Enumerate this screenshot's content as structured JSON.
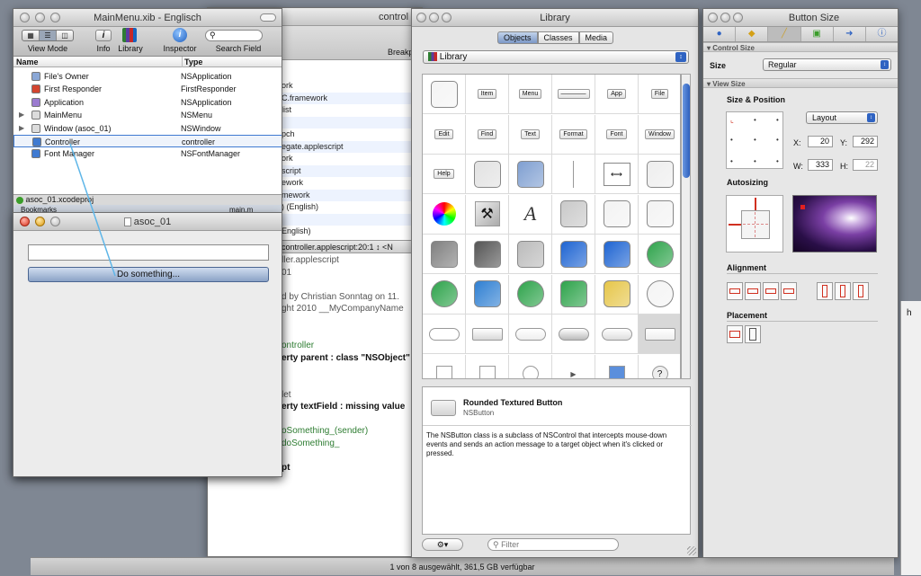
{
  "background": {
    "color": "#7f8793"
  },
  "project_window": {
    "title": "control",
    "toolbar_label": "Breakp",
    "code_lines": [
      {
        "text": "ork",
        "color": "#222"
      },
      {
        "text": "C.framework",
        "color": "#222"
      },
      {
        "text": "list",
        "color": "#222"
      },
      {
        "text": "",
        "color": "#222"
      },
      {
        "text": "pch",
        "color": "#222"
      },
      {
        "text": "egate.applescript",
        "color": "#222"
      },
      {
        "text": "ork",
        "color": "#222"
      },
      {
        "text": "script",
        "color": "#222"
      },
      {
        "text": "ework",
        "color": "#222"
      },
      {
        "text": "mework",
        "color": "#222"
      },
      {
        "text": ") (English)",
        "color": "#222"
      },
      {
        "text": "",
        "color": "#222"
      },
      {
        "text": "English)",
        "color": "#222"
      }
    ],
    "file_path": "controller.applescript:20:1 ↕  <N",
    "source_lines": [
      "ller.applescript",
      "01",
      "",
      "d by Christian Sonntag on 11.",
      "ght 2010 __MyCompanyName",
      "",
      "",
      "ontroller",
      "erty parent : class \"NSObject\"",
      "",
      "",
      "let",
      "erty textField : missing value",
      "",
      "oSomething_(sender)",
      "doSomething_",
      "",
      "pt"
    ],
    "status": "1 von 8 ausgewählt, 361,5 GB verfügbar"
  },
  "mainmenu_window": {
    "title": "MainMenu.xib - Englisch",
    "toolbar": {
      "view_mode": "View Mode",
      "info": "Info",
      "library": "Library",
      "inspector": "Inspector",
      "search_field": "Search Field"
    },
    "columns": {
      "name": "Name",
      "type": "Type"
    },
    "rows": [
      {
        "name": "File's Owner",
        "type": "NSApplication",
        "icon": "cube-icon",
        "color": "#8aa7d6"
      },
      {
        "name": "First Responder",
        "type": "FirstResponder",
        "icon": "red-cube-icon",
        "color": "#d4452f"
      },
      {
        "name": "Application",
        "type": "NSApplication",
        "icon": "app-icon",
        "color": "#9b7bd0"
      },
      {
        "name": "MainMenu",
        "type": "NSMenu",
        "icon": "menu-icon",
        "color": "#dcdcdc"
      },
      {
        "name": "Window (asoc_01)",
        "type": "NSWindow",
        "icon": "window-icon",
        "color": "#dcdcdc"
      },
      {
        "name": "Controller",
        "type": "controller",
        "icon": "blue-cube-icon",
        "color": "#3f7ad1"
      },
      {
        "name": "Font Manager",
        "type": "NSFontManager",
        "icon": "blue-cube-icon",
        "color": "#3f7ad1"
      }
    ],
    "project_status": "asoc_01.xcodeproj",
    "bookmarks": "Bookmarks",
    "main_file": "main.m"
  },
  "asoc_window": {
    "title": "asoc_01",
    "button_label": "Do something..."
  },
  "library_window": {
    "title": "Library",
    "tabs": [
      "Objects",
      "Classes",
      "Media"
    ],
    "popup": "Library",
    "palette_rows": [
      [
        "",
        "Item",
        "Menu",
        "————",
        "App",
        "File"
      ],
      [
        "Edit",
        "Find",
        "Text",
        "Format",
        "Font",
        "Window"
      ],
      [
        "Help",
        "",
        "",
        "",
        "",
        ""
      ]
    ],
    "detail": {
      "title": "Rounded Textured Button",
      "class": "NSButton",
      "description": "The NSButton class is a subclass of NSControl that intercepts mouse-down events and sends an action message to a target object when it's clicked or pressed."
    },
    "filter_placeholder": "Filter"
  },
  "inspector_window": {
    "title": "Button Size",
    "control_size_header": "Control Size",
    "size_label": "Size",
    "size_value": "Regular",
    "view_size_header": "View Size",
    "size_position_label": "Size & Position",
    "layout_value": "Layout",
    "x_label": "X:",
    "x_value": "20",
    "y_label": "Y:",
    "y_value": "292",
    "w_label": "W:",
    "w_value": "333",
    "h_label": "H:",
    "h_value": "22",
    "autosizing_label": "Autosizing",
    "alignment_label": "Alignment",
    "placement_label": "Placement"
  },
  "right_edge": {
    "text": "h"
  }
}
